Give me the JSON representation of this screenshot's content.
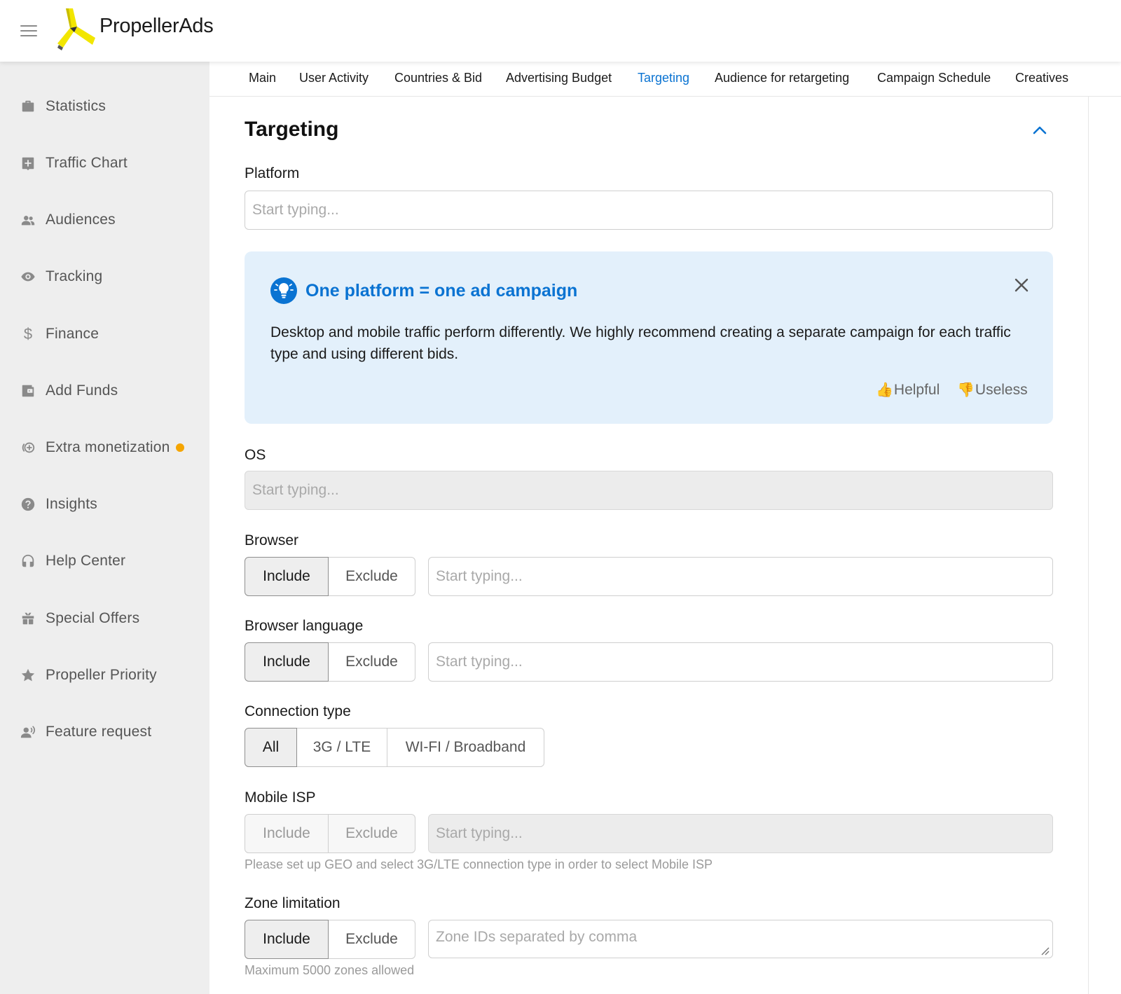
{
  "header": {
    "brand": "PropellerAds"
  },
  "sidebar": {
    "items": [
      {
        "label": "Statistics",
        "icon": "briefcase-icon"
      },
      {
        "label": "Traffic Chart",
        "icon": "chart-icon"
      },
      {
        "label": "Audiences",
        "icon": "people-icon"
      },
      {
        "label": "Tracking",
        "icon": "eye-icon"
      },
      {
        "label": "Finance",
        "icon": "dollar-icon"
      },
      {
        "label": "Add Funds",
        "icon": "wallet-icon"
      },
      {
        "label": "Extra monetization",
        "icon": "coin-plus-icon",
        "badge_color": "#f5a500"
      },
      {
        "label": "Insights",
        "icon": "question-icon"
      },
      {
        "label": "Help Center",
        "icon": "headset-icon"
      },
      {
        "label": "Special Offers",
        "icon": "gift-icon"
      },
      {
        "label": "Propeller Priority",
        "icon": "star-icon"
      },
      {
        "label": "Feature request",
        "icon": "person-speaking-icon"
      }
    ]
  },
  "tabs": [
    {
      "label": "Main"
    },
    {
      "label": "User Activity"
    },
    {
      "label": "Countries & Bid"
    },
    {
      "label": "Advertising Budget"
    },
    {
      "label": "Targeting",
      "active": true
    },
    {
      "label": "Audience for retargeting"
    },
    {
      "label": "Campaign Schedule"
    },
    {
      "label": "Creatives"
    }
  ],
  "section": {
    "title": "Targeting"
  },
  "platform": {
    "label": "Platform",
    "placeholder": "Start typing..."
  },
  "info": {
    "title": "One platform = one ad campaign",
    "text": "Desktop and mobile traffic perform differently. We highly recommend creating a separate campaign for each traffic type and using different bids.",
    "helpful": "Helpful",
    "useless": "Useless",
    "helpful_emoji": "👍",
    "useless_emoji": "👎"
  },
  "os": {
    "label": "OS",
    "placeholder": "Start typing..."
  },
  "browser": {
    "label": "Browser",
    "include": "Include",
    "exclude": "Exclude",
    "placeholder": "Start typing..."
  },
  "browser_language": {
    "label": "Browser language",
    "include": "Include",
    "exclude": "Exclude",
    "placeholder": "Start typing..."
  },
  "connection_type": {
    "label": "Connection type",
    "options": [
      "All",
      "3G / LTE",
      "WI-FI / Broadband"
    ],
    "selected": "All"
  },
  "mobile_isp": {
    "label": "Mobile ISP",
    "include": "Include",
    "exclude": "Exclude",
    "placeholder": "Start typing...",
    "hint": "Please set up GEO and select 3G/LTE connection type in order to select Mobile ISP"
  },
  "zone_limitation": {
    "label": "Zone limitation",
    "include": "Include",
    "exclude": "Exclude",
    "placeholder": "Zone IDs separated by comma",
    "hint": "Maximum 5000 zones allowed"
  },
  "colors": {
    "accent": "#0a73d2",
    "info_bg": "#e3f0fb",
    "sidebar_bg": "#eeeeee",
    "badge": "#f5a500"
  }
}
